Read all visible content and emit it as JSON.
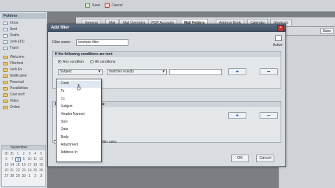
{
  "topbar": {
    "items": [
      "Save",
      "Cancel"
    ]
  },
  "sidebar": {
    "header": "Folders",
    "folders": [
      "Inbox",
      "Sent",
      "Drafts",
      "Junk (33)",
      "Trash",
      "Welcome",
      "Filtertest",
      "Junk Ex",
      "Notification",
      "Personal",
      "Possibilities",
      "Cool stuff",
      "Video",
      "Online"
    ],
    "calendar": {
      "month": "September",
      "days": [
        "30",
        "31",
        "1",
        "2",
        "3",
        "4",
        "5",
        "6",
        "7",
        "8",
        "9",
        "10",
        "11",
        "12",
        "13",
        "14",
        "15",
        "16",
        "17",
        "18",
        "19",
        "20",
        "21",
        "22",
        "23",
        "24",
        "25",
        "26",
        "27",
        "28",
        "29",
        "30",
        "1",
        "2",
        "3"
      ]
    }
  },
  "tabs": [
    "General",
    "Mail",
    "Mail Overrides",
    "POP Accounts",
    "Mail Folders",
    "Address Book",
    "Calendar",
    "Shortcuts"
  ],
  "main_toolbar": {
    "save_label": "Save"
  },
  "dialog": {
    "title": "Add filter",
    "filter_name_label": "Filter name:",
    "filter_name_value": "example filter",
    "active_label": "Active",
    "conditions": {
      "heading": "If the following conditions are met:",
      "any_label": "Any condition",
      "all_label": "All conditions",
      "field_value": "Subject",
      "operator_value": "matches exactly",
      "value_text": ""
    },
    "actions": {
      "heading": "Perform the following actions:"
    },
    "stop_label": "Stop processing additional filter rules",
    "ok_label": "OK",
    "cancel_label": "Cancel"
  },
  "dropdown": {
    "options": [
      "From",
      "To",
      "Cc",
      "Subject",
      "Header Named",
      "Size",
      "Date",
      "Body",
      "Attachment",
      "Address In"
    ],
    "selected": "From"
  }
}
